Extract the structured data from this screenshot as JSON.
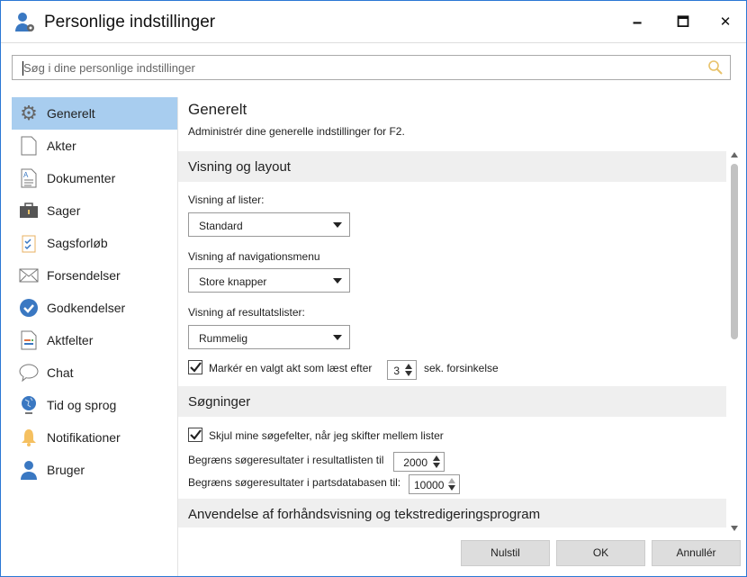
{
  "window": {
    "title": "Personlige indstillinger",
    "minimize": "🗕",
    "maximize": "🗖",
    "close": "✕"
  },
  "search": {
    "placeholder": "Søg i dine personlige indstillinger"
  },
  "sidebar": {
    "items": [
      {
        "label": "Generelt",
        "icon": "gear-icon"
      },
      {
        "label": "Akter",
        "icon": "document-icon"
      },
      {
        "label": "Dokumenter",
        "icon": "text-document-icon"
      },
      {
        "label": "Sager",
        "icon": "briefcase-icon"
      },
      {
        "label": "Sagsforløb",
        "icon": "clipboard-check-icon"
      },
      {
        "label": "Forsendelser",
        "icon": "envelope-icon"
      },
      {
        "label": "Godkendelser",
        "icon": "check-circle-icon"
      },
      {
        "label": "Aktfelter",
        "icon": "form-icon"
      },
      {
        "label": "Chat",
        "icon": "speech-bubble-icon"
      },
      {
        "label": "Tid og sprog",
        "icon": "globe-icon"
      },
      {
        "label": "Notifikationer",
        "icon": "bell-icon"
      },
      {
        "label": "Bruger",
        "icon": "user-icon"
      }
    ]
  },
  "main": {
    "title": "Generelt",
    "subtitle": "Administrér dine generelle indstillinger for F2.",
    "sections": {
      "view": {
        "title": "Visning og layout",
        "list_label": "Visning af lister:",
        "list_value": "Standard",
        "nav_label": "Visning af navigationsmenu",
        "nav_value": "Store knapper",
        "result_label": "Visning af resultatslister:",
        "result_value": "Rummelig",
        "mark_read_label": "Markér en valgt akt som læst efter",
        "mark_read_checked": true,
        "mark_read_delay": "3",
        "mark_read_suffix": "sek. forsinkelse"
      },
      "search": {
        "title": "Søgninger",
        "hide_label": "Skjul mine søgefelter, når jeg skifter mellem lister",
        "hide_checked": true,
        "limit_results_label": "Begræns søgeresultater i resultatlisten til",
        "limit_results_value": "2000",
        "limit_party_label": "Begræns søgeresultater i partsdatabasen til:",
        "limit_party_value": "10000"
      },
      "preview": {
        "title": "Anvendelse af forhåndsvisning og tekstredigeringsprogram"
      }
    }
  },
  "footer": {
    "reset": "Nulstil",
    "ok": "OK",
    "cancel": "Annullér"
  },
  "colors": {
    "accent": "#2b78d4",
    "selected": "#a8cdef"
  }
}
